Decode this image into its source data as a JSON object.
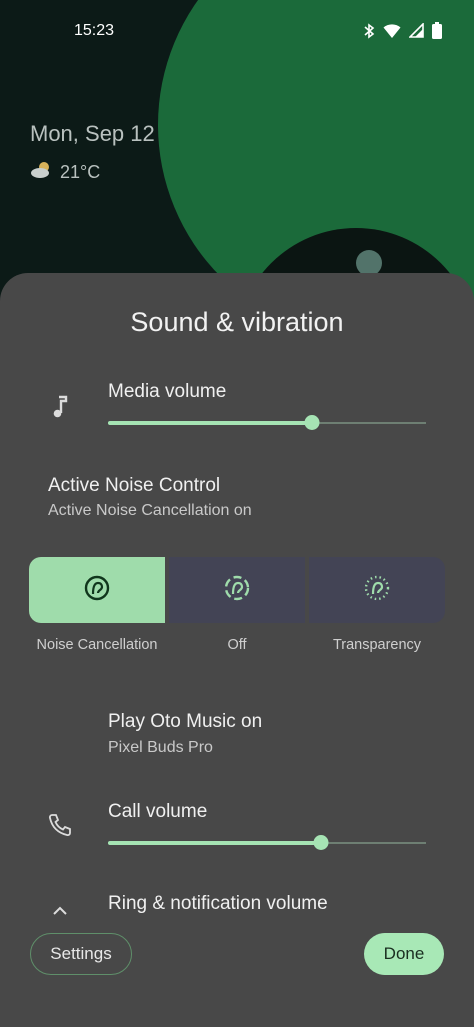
{
  "status_bar": {
    "time": "15:23",
    "icons": [
      "bluetooth-icon",
      "wifi-icon",
      "signal-icon",
      "battery-icon"
    ]
  },
  "lockscreen": {
    "date": "Mon, Sep 12",
    "weather_icon": "cloud-sun-icon",
    "temperature": "21°C"
  },
  "panel": {
    "title": "Sound & vibration",
    "media_volume": {
      "label": "Media volume",
      "icon": "music-note-icon",
      "level": 0.64
    },
    "anc": {
      "title": "Active Noise Control",
      "subtitle": "Active Noise Cancellation on",
      "options": [
        {
          "label": "Noise Cancellation",
          "icon": "noise-cancellation-icon",
          "selected": true
        },
        {
          "label": "Off",
          "icon": "anc-off-icon",
          "selected": false
        },
        {
          "label": "Transparency",
          "icon": "transparency-icon",
          "selected": false
        }
      ]
    },
    "play_on": {
      "title": "Play Oto Music on",
      "device": "Pixel Buds Pro"
    },
    "call_volume": {
      "label": "Call volume",
      "icon": "phone-icon",
      "level": 0.67
    },
    "ring_volume": {
      "label": "Ring & notification volume",
      "icon": "chevron-up-icon"
    },
    "buttons": {
      "settings": "Settings",
      "done": "Done"
    }
  },
  "colors": {
    "accent": "#a6e4b4",
    "panel_bg": "#484848",
    "segment_selected": "#9fdcab",
    "segment_unselected": "#434455"
  }
}
